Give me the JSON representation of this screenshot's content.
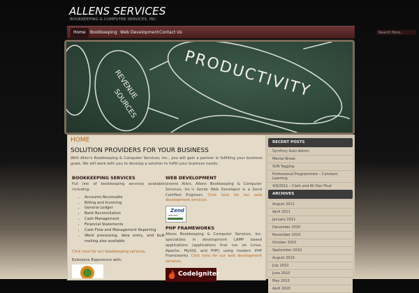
{
  "site": {
    "title": "ALLENS SERVICES",
    "tagline": "BOOKKEEPING & COMPUTER SERVICES, INC."
  },
  "nav": {
    "items": [
      {
        "label": "Home",
        "active": true
      },
      {
        "label": "Bookkeeping",
        "active": false
      },
      {
        "label": "Web Development",
        "active": false
      },
      {
        "label": "Contact Us",
        "active": false
      }
    ],
    "search_placeholder": "Search Here..."
  },
  "banner": {
    "words": [
      "PRODUCTIVITY",
      "REVENUE",
      "SOURCES"
    ]
  },
  "main": {
    "heading": "HOME",
    "subheading": "SOLUTION PROVIDERS FOR YOUR BUSINESS",
    "intro": "With Allen's Bookkeeping & Computer Services, Inc., you will gain a partner in fulfilling your business goals. We will work with you to develop a solution to fulfill your business needs.",
    "bookkeeping": {
      "heading": "BOOKKEEPING SERVICES",
      "text": "Full line of bookkeeping services available including:",
      "services": [
        "Accounts Receivable",
        "Billing and Invoicing",
        "General Ledger",
        "Bank Reconciliation",
        "Cash Management",
        "Financial Statements",
        "Cash Flow and Management Reporting",
        "Word processing, data entry, and bulk mailing also available"
      ],
      "link": "Click here for our bookkeeping services.",
      "experience": "Extensive Experience with:"
    },
    "webdev": {
      "heading": "WEB DEVELOPMENT",
      "text": "Jereme Allen, Allens Bookkeeping & Computer Services, Inc.'s Senior Web Developer is a Zend Certified Engineer.",
      "link": "Click here for our web development services.",
      "zend_label": "Zend",
      "zend_sub": "CERTIFIED ENGINEER"
    },
    "php": {
      "heading": "PHP FRAMEWORKS",
      "text": "Allens Bookkeeping & Computer Services, Inc. specializes in development LAMP based applications (applications that run on Linux, Apache, MySQL and PHP) using modern PHP Frameworks.",
      "link": "Click here for our web development services.",
      "ci_label": "CodeIgniter"
    }
  },
  "sidebar": {
    "recent_title": "RECENT POSTS",
    "recent": [
      "Symfony Auto Admin",
      "Mental Break",
      "SVN Tagging",
      "Professional Programmers – Constant Learning",
      "4/9/2011 – Clark and All Star Final"
    ],
    "archives_title": "ARCHIVES",
    "archives": [
      "August 2011",
      "April 2011",
      "January 2011",
      "December 2010",
      "November 2010",
      "October 2010",
      "September 2010",
      "August 2010",
      "July 2010",
      "June 2010",
      "May 2010",
      "April 2010"
    ]
  }
}
